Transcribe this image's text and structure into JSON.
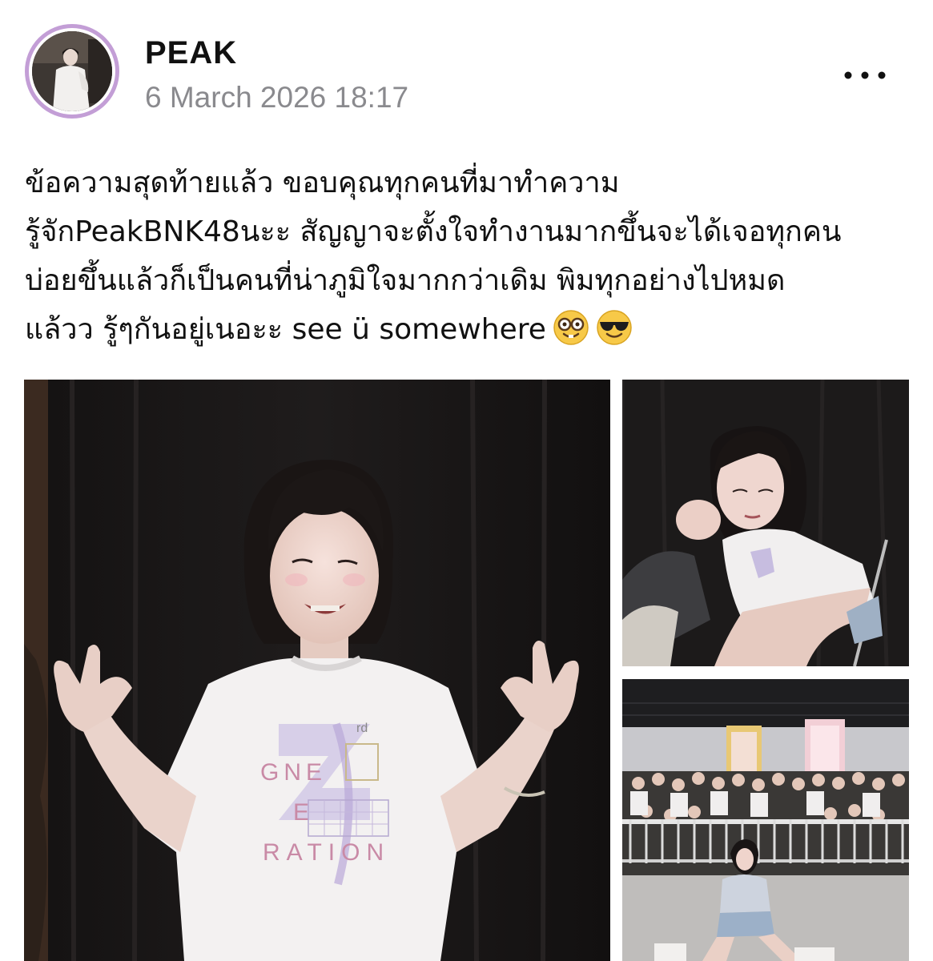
{
  "post": {
    "author": {
      "name": "PEAK",
      "avatar_ring_color": "#c39ed6"
    },
    "timestamp": "6 March 2026 18:17",
    "more_icon": "ellipsis-horizontal-icon",
    "caption_lines": [
      "ข้อความสุดท้ายแล้ว ขอบคุณทุกคนที่มาทำความ",
      "รู้จักPeakBNK48นะะ สัญญาจะตั้งใจทำงานมากขึ้นจะได้เจอทุกคน",
      "บ่อยขึ้นแล้วก็เป็นคนที่น่าภูมิใจมากกว่าเดิม พิมทุกอย่างไปหมด",
      "แล้วว รู้ๆกันอยู่เนอะะ see ü somewhere"
    ],
    "caption_emojis": [
      "nerd-face-emoji",
      "smiling-face-with-sunglasses-emoji"
    ],
    "photos": {
      "main": {
        "shirt_text_lines": [
          "GNE",
          "E",
          "RATION"
        ],
        "shirt_small": "rd"
      },
      "bottom": {
        "banner_left": "",
        "banner_right": ""
      }
    }
  }
}
